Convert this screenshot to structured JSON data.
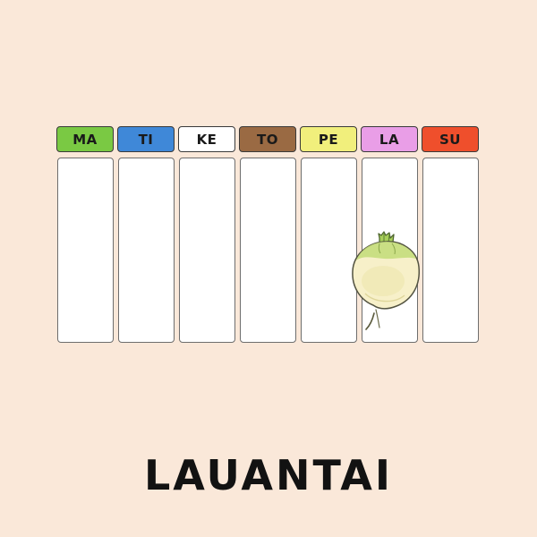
{
  "days": [
    {
      "label": "MA",
      "color": "#7ac943"
    },
    {
      "label": "TI",
      "color": "#3f88d8"
    },
    {
      "label": "KE",
      "color": "#ffffff"
    },
    {
      "label": "TO",
      "color": "#9a6a43"
    },
    {
      "label": "PE",
      "color": "#f1ef7c"
    },
    {
      "label": "LA",
      "color": "#e99ee7"
    },
    {
      "label": "SU",
      "color": "#ef4f2c"
    }
  ],
  "marker": {
    "day": "LA",
    "icon": "turnip-icon"
  },
  "current_day_name": "LAUANTAI",
  "colors": {
    "background": "#fae8d9",
    "box": "#ffffff",
    "text": "#121212"
  }
}
